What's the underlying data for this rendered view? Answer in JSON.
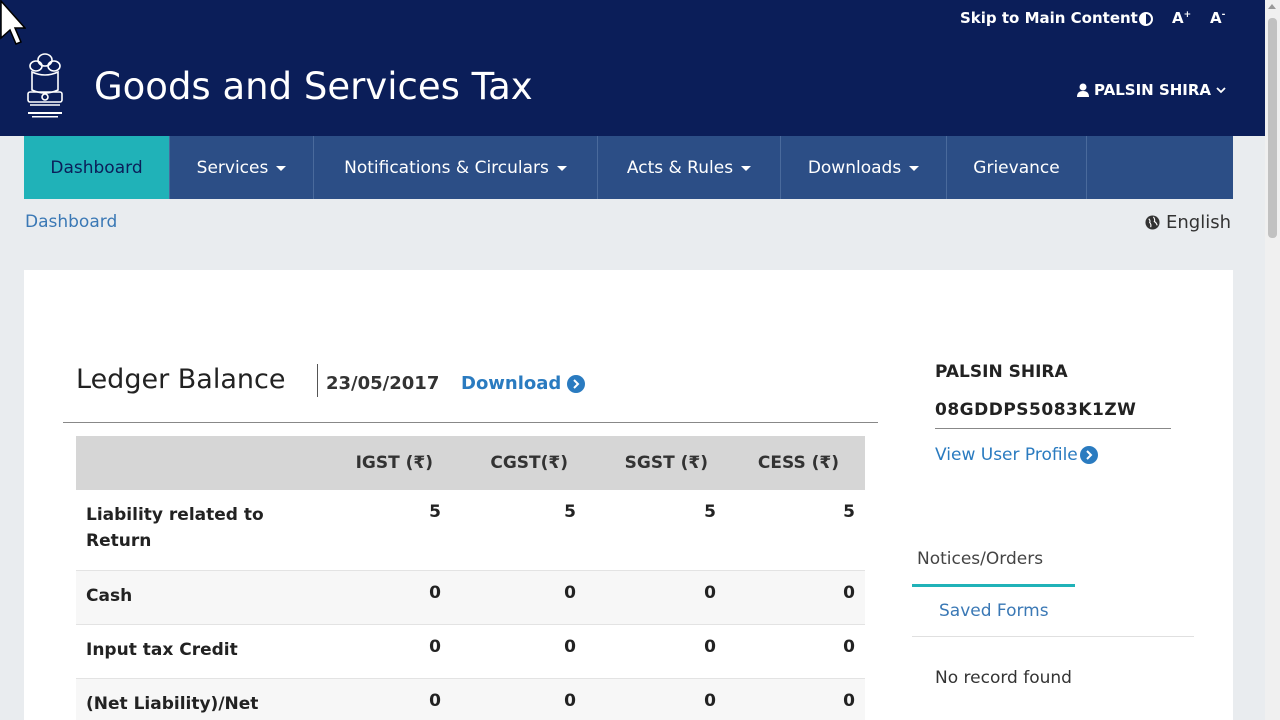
{
  "topbar": {
    "skip_label": "Skip to Main Content",
    "font_increase": "A",
    "font_increase_sup": "+",
    "font_decrease": "A",
    "font_decrease_sup": "-"
  },
  "header": {
    "title": "Goods and Services Tax",
    "user": "PALSIN SHIRA"
  },
  "nav": {
    "items": [
      {
        "label": "Dashboard",
        "active": true
      },
      {
        "label": "Services"
      },
      {
        "label": "Notifications & Circulars"
      },
      {
        "label": "Acts & Rules"
      },
      {
        "label": "Downloads"
      },
      {
        "label": "Grievance"
      }
    ]
  },
  "breadcrumb": "Dashboard",
  "language": "English",
  "ledger": {
    "title": "Ledger Balance",
    "date": "23/05/2017",
    "download_label": "Download",
    "columns": [
      "",
      "IGST (₹)",
      "CGST(₹)",
      "SGST (₹)",
      "CESS (₹)"
    ],
    "rows": [
      {
        "label": "Liability related to Return",
        "values": [
          "5",
          "5",
          "5",
          "5"
        ]
      },
      {
        "label": "Cash",
        "values": [
          "0",
          "0",
          "0",
          "0"
        ]
      },
      {
        "label": "Input tax Credit",
        "values": [
          "0",
          "0",
          "0",
          "0"
        ]
      },
      {
        "label": "(Net Liability)/Net",
        "values": [
          "0",
          "0",
          "0",
          "0"
        ]
      }
    ]
  },
  "profile": {
    "name": "PALSIN SHIRA",
    "gstin": "08GDDPS5083K1ZW",
    "view_profile_label": "View User Profile"
  },
  "tabs": {
    "notices": "Notices/Orders",
    "saved": "Saved Forms"
  },
  "empty_message": "No record found",
  "colors": {
    "header_bg": "#0b1e59",
    "nav_bg": "#2c4e86",
    "nav_active": "#20b2b8",
    "link": "#2a7bc0"
  }
}
